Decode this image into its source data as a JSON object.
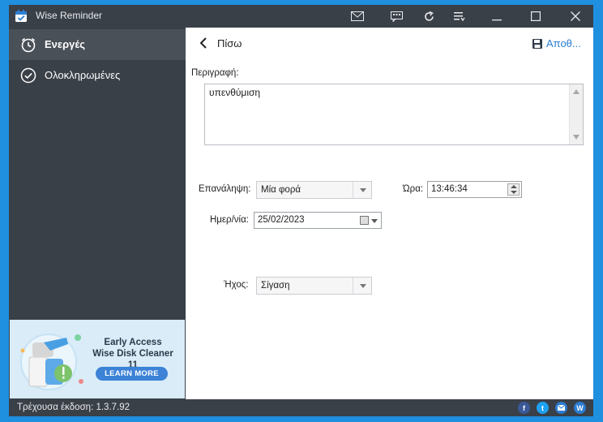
{
  "window": {
    "title": "Wise Reminder"
  },
  "sidebar": {
    "items": [
      {
        "label": "Ενεργές",
        "icon": "clock-icon",
        "active": true
      },
      {
        "label": "Ολοκληρωμένες",
        "icon": "check-circle-icon",
        "active": false
      }
    ],
    "ad": {
      "line1": "Early Access",
      "line2": "Wise Disk Cleaner 11",
      "button": "LEARN MORE"
    }
  },
  "main": {
    "back_label": "Πίσω",
    "save_label": "Αποθ...",
    "description_label": "Περιγραφή:",
    "description_value": "υπενθύμιση",
    "repeat_label": "Επανάληψη:",
    "repeat_value": "Μία φορά",
    "time_label": "Ώρα:",
    "time_value": "13:46:34",
    "date_label": "Ημερ/νία:",
    "date_value": "25/02/2023",
    "sound_label": "Ήχος:",
    "sound_value": "Σίγαση"
  },
  "statusbar": {
    "version_text": "Τρέχουσα έκδοση: 1.3.7.92",
    "social": [
      "f",
      "t",
      "m",
      "W"
    ]
  },
  "colors": {
    "sidebar_bg": "#3a4048",
    "active_item_bg": "#4a5058",
    "accent": "#2b7bd1",
    "desktop": "#1f8fe0"
  }
}
